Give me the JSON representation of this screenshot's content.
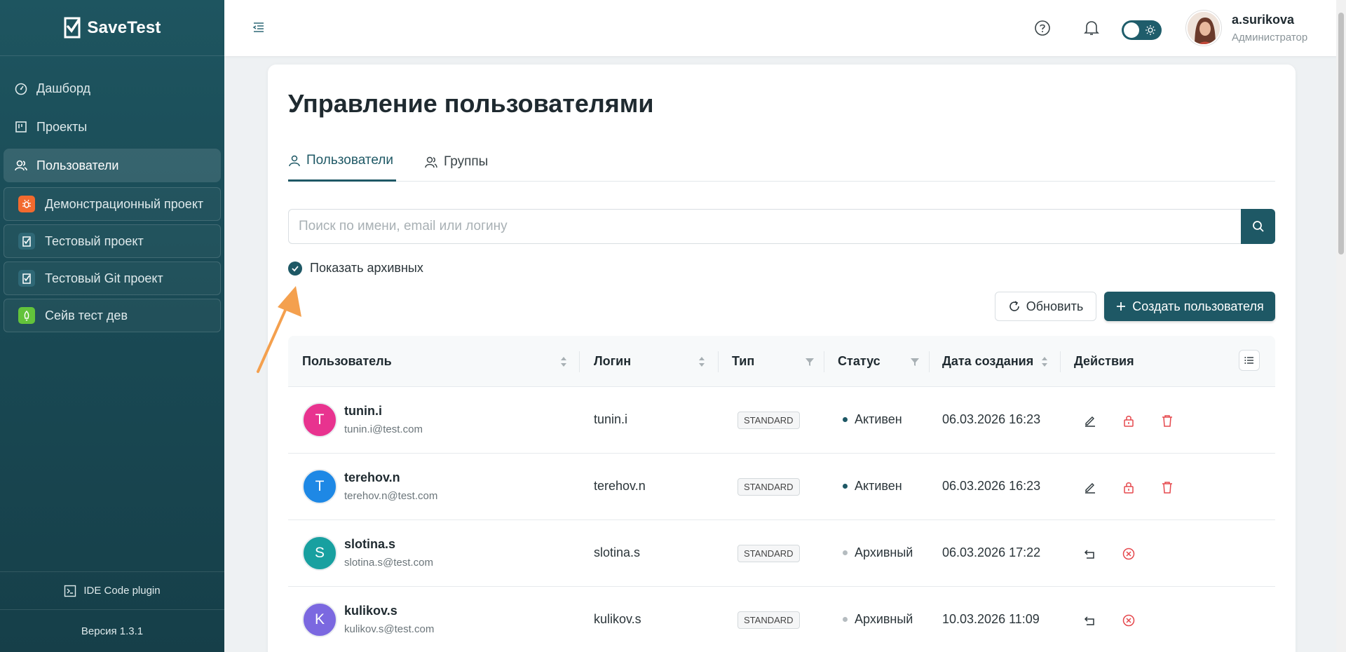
{
  "app": {
    "name": "SaveTest"
  },
  "sidebar": {
    "nav": [
      {
        "label": "Дашборд",
        "icon": "dashboard-icon"
      },
      {
        "label": "Проекты",
        "icon": "projects-icon"
      },
      {
        "label": "Пользователи",
        "icon": "users-icon",
        "active": true
      }
    ],
    "projects": [
      {
        "label": "Демонстрационный проект",
        "color": "#f26a2e"
      },
      {
        "label": "Тестовый проект",
        "color": "#2f6876"
      },
      {
        "label": "Тестовый Git проект",
        "color": "#2f6876"
      },
      {
        "label": "Сейв тест дев",
        "color": "#63c33b"
      }
    ],
    "ide_plugin": "IDE Code plugin",
    "version": "Версия 1.3.1"
  },
  "header": {
    "user_name": "a.surikova",
    "user_role": "Администратор"
  },
  "page": {
    "title": "Управление пользователями",
    "tabs": [
      {
        "label": "Пользователи",
        "active": true
      },
      {
        "label": "Группы"
      }
    ],
    "search_placeholder": "Поиск по имени, email или логину",
    "show_archived_label": "Показать архивных",
    "show_archived_checked": true,
    "refresh_label": "Обновить",
    "create_label": "Создать пользователя"
  },
  "table": {
    "columns": [
      "Пользователь",
      "Логин",
      "Тип",
      "Статус",
      "Дата создания",
      "Действия"
    ],
    "rows": [
      {
        "initial": "T",
        "name": "tunin.i",
        "email": "tunin.i@test.com",
        "login": "tunin.i",
        "type": "STANDARD",
        "status": "Активен",
        "created": "06.03.2026 16:23",
        "avatar_color": "#e8338f",
        "archived": false
      },
      {
        "initial": "T",
        "name": "terehov.n",
        "email": "terehov.n@test.com",
        "login": "terehov.n",
        "type": "STANDARD",
        "status": "Активен",
        "created": "06.03.2026 16:23",
        "avatar_color": "#1e88e5",
        "archived": false
      },
      {
        "initial": "S",
        "name": "slotina.s",
        "email": "slotina.s@test.com",
        "login": "slotina.s",
        "type": "STANDARD",
        "status": "Архивный",
        "created": "06.03.2026 17:22",
        "avatar_color": "#18a0a0",
        "archived": true
      },
      {
        "initial": "K",
        "name": "kulikov.s",
        "email": "kulikov.s@test.com",
        "login": "kulikov.s",
        "type": "STANDARD",
        "status": "Архивный",
        "created": "10.03.2026 11:09",
        "avatar_color": "#7b68e0",
        "archived": true
      }
    ]
  }
}
